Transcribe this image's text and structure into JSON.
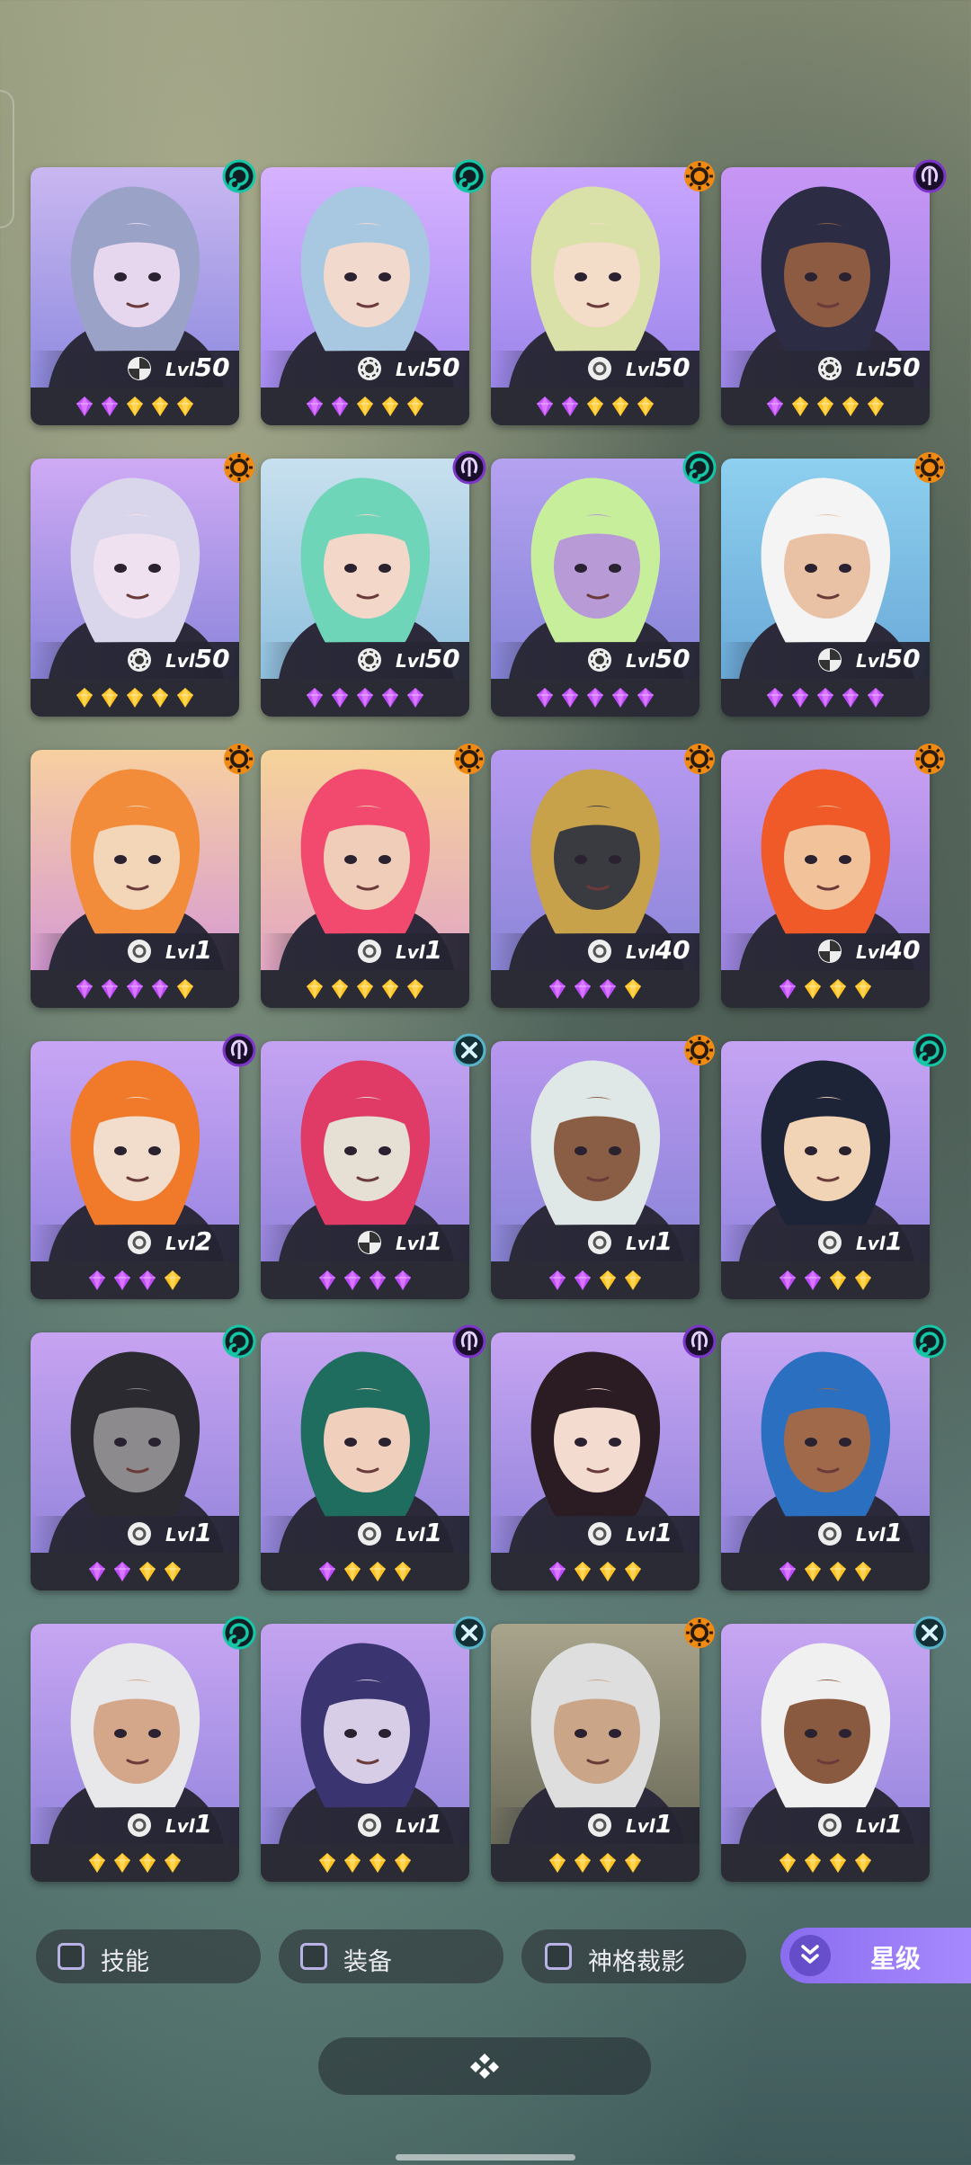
{
  "heroes": [
    {
      "level": 50,
      "element": "swirl",
      "role": "assassin",
      "bg": [
        "#c9b7f0",
        "#8f8be0"
      ],
      "skin": "#e6d7ee",
      "hair": "#9aa2c8",
      "gems": [
        "purple",
        "purple",
        "gold",
        "gold",
        "gold"
      ]
    },
    {
      "level": 50,
      "element": "swirl",
      "role": "mage",
      "bg": [
        "#d6b2ff",
        "#a68cf2"
      ],
      "skin": "#f2d9cd",
      "hair": "#a7c8e0",
      "gems": [
        "purple",
        "purple",
        "gold",
        "gold",
        "gold"
      ]
    },
    {
      "level": 50,
      "element": "sun",
      "role": "support",
      "bg": [
        "#c9a6ff",
        "#9b86ea"
      ],
      "skin": "#f4ddc8",
      "hair": "#d9e0a8",
      "gems": [
        "purple",
        "purple",
        "gold",
        "gold",
        "gold"
      ]
    },
    {
      "level": 50,
      "element": "wisdom",
      "role": "mage",
      "bg": [
        "#c896f5",
        "#9a86e6"
      ],
      "skin": "#8c5b42",
      "hair": "#2c2d45",
      "gems": [
        "purple",
        "gold",
        "gold",
        "gold",
        "gold"
      ]
    },
    {
      "level": 50,
      "element": "sun",
      "role": "mage",
      "bg": [
        "#cfaaf5",
        "#8a84da"
      ],
      "skin": "#efe1ef",
      "hair": "#d9d5ea",
      "gems": [
        "gold",
        "gold",
        "gold",
        "gold",
        "gold"
      ]
    },
    {
      "level": 50,
      "element": "wisdom",
      "role": "mage",
      "bg": [
        "#c8e0ee",
        "#8ec0de"
      ],
      "skin": "#f3d7c9",
      "hair": "#6fd5b9",
      "gems": [
        "purple",
        "purple",
        "purple",
        "purple",
        "purple"
      ]
    },
    {
      "level": 50,
      "element": "swirl",
      "role": "mage",
      "bg": [
        "#b5a2f0",
        "#8684d8"
      ],
      "skin": "#b79ad6",
      "hair": "#c7ef9b",
      "gems": [
        "purple",
        "purple",
        "purple",
        "purple",
        "purple"
      ]
    },
    {
      "level": 50,
      "element": "sun",
      "role": "assassin",
      "bg": [
        "#8ed0ef",
        "#6aa9d8"
      ],
      "skin": "#e9c2a5",
      "hair": "#f4f4f4",
      "gems": [
        "purple",
        "purple",
        "purple",
        "purple",
        "purple"
      ]
    },
    {
      "level": 1,
      "element": "sun",
      "role": "support",
      "bg": [
        "#f7d0a0",
        "#d79ad4"
      ],
      "skin": "#f3d6b8",
      "hair": "#f28c3a",
      "gems": [
        "purple",
        "purple",
        "purple",
        "purple",
        "gold"
      ]
    },
    {
      "level": 1,
      "element": "sun",
      "role": "support",
      "bg": [
        "#f6d39a",
        "#e3a6c4"
      ],
      "skin": "#f0cdb8",
      "hair": "#f24a6e",
      "gems": [
        "gold",
        "gold",
        "gold",
        "gold",
        "gold"
      ]
    },
    {
      "level": 40,
      "element": "sun",
      "role": "support",
      "bg": [
        "#b799f0",
        "#8b86d8"
      ],
      "skin": "#3a3b40",
      "hair": "#c8a24a",
      "gems": [
        "purple",
        "purple",
        "purple",
        "gold"
      ]
    },
    {
      "level": 40,
      "element": "sun",
      "role": "assassin",
      "bg": [
        "#c9a0f2",
        "#9a84e0"
      ],
      "skin": "#f2c29a",
      "hair": "#f05a28",
      "gems": [
        "purple",
        "gold",
        "gold",
        "gold"
      ]
    },
    {
      "level": 2,
      "element": "wisdom",
      "role": "support",
      "bg": [
        "#c9a6f5",
        "#9684e0"
      ],
      "skin": "#f2dccb",
      "hair": "#f0792a",
      "gems": [
        "purple",
        "purple",
        "purple",
        "gold"
      ]
    },
    {
      "level": 1,
      "element": "cross",
      "role": "assassin",
      "bg": [
        "#c5a3f2",
        "#9483dc"
      ],
      "skin": "#e6e0d4",
      "hair": "#e03a66",
      "gems": [
        "purple",
        "purple",
        "purple",
        "purple"
      ]
    },
    {
      "level": 1,
      "element": "sun",
      "role": "support",
      "bg": [
        "#b896ee",
        "#8a86d8"
      ],
      "skin": "#8a5e45",
      "hair": "#dfe8e6",
      "gems": [
        "purple",
        "purple",
        "gold",
        "gold"
      ]
    },
    {
      "level": 1,
      "element": "swirl",
      "role": "support",
      "bg": [
        "#c6a4f3",
        "#9586e0"
      ],
      "skin": "#f1d3b6",
      "hair": "#1e2438",
      "gems": [
        "purple",
        "purple",
        "gold",
        "gold"
      ]
    },
    {
      "level": 1,
      "element": "swirl",
      "role": "support",
      "bg": [
        "#c7a3f1",
        "#9586dd"
      ],
      "skin": "#8c8a8c",
      "hair": "#2a2a30",
      "gems": [
        "purple",
        "purple",
        "gold",
        "gold"
      ]
    },
    {
      "level": 1,
      "element": "wisdom",
      "role": "support",
      "bg": [
        "#c5a4f1",
        "#9486dc"
      ],
      "skin": "#f0d0bd",
      "hair": "#1f6d5f",
      "gems": [
        "purple",
        "gold",
        "gold",
        "gold"
      ]
    },
    {
      "level": 1,
      "element": "wisdom",
      "role": "support",
      "bg": [
        "#c7a5f2",
        "#9384dc"
      ],
      "skin": "#f3dbcf",
      "hair": "#2a1c22",
      "gems": [
        "purple",
        "gold",
        "gold",
        "gold"
      ]
    },
    {
      "level": 1,
      "element": "swirl",
      "role": "support",
      "bg": [
        "#c6a5f2",
        "#9485dd"
      ],
      "skin": "#a06a4a",
      "hair": "#2a6fc0",
      "gems": [
        "purple",
        "gold",
        "gold",
        "gold"
      ]
    },
    {
      "level": 1,
      "element": "swirl",
      "role": "support",
      "bg": [
        "#c7a6f2",
        "#9586de"
      ],
      "skin": "#d4a78a",
      "hair": "#e8e8ea",
      "gems": [
        "gold",
        "gold",
        "gold",
        "gold"
      ]
    },
    {
      "level": 1,
      "element": "cross",
      "role": "support",
      "bg": [
        "#c4a3f0",
        "#9084da"
      ],
      "skin": "#d8cde6",
      "hair": "#3a3570",
      "gems": [
        "gold",
        "gold",
        "gold",
        "gold"
      ]
    },
    {
      "level": 1,
      "element": "sun",
      "role": "support",
      "bg": [
        "#a9a48c",
        "#6a6a58"
      ],
      "skin": "#caa588",
      "hair": "#dedede",
      "gems": [
        "gold",
        "gold",
        "gold",
        "gold"
      ]
    },
    {
      "level": 1,
      "element": "cross",
      "role": "support",
      "bg": [
        "#c8a6f2",
        "#9586de"
      ],
      "skin": "#8a5a40",
      "hair": "#f0f0f0",
      "gems": [
        "gold",
        "gold",
        "gold",
        "gold"
      ]
    }
  ],
  "level_prefix": "Lvl",
  "filters": {
    "skill": "技能",
    "equipment": "装备",
    "divine_shadow": "神格裁影"
  },
  "sort": {
    "label": "星级",
    "icon": "double-chevron-down-icon"
  },
  "collapse": {
    "icon": "collapse-diamond-icon"
  },
  "colors": {
    "gem_purple": "#c14cff",
    "gem_gold": "#ffc21c",
    "element_swirl": "#15c7a6",
    "element_sun": "#f08a12",
    "element_wisdom": "#7c35c9",
    "element_cross": "#5ab4c9",
    "accent": "#9a7cf8"
  }
}
